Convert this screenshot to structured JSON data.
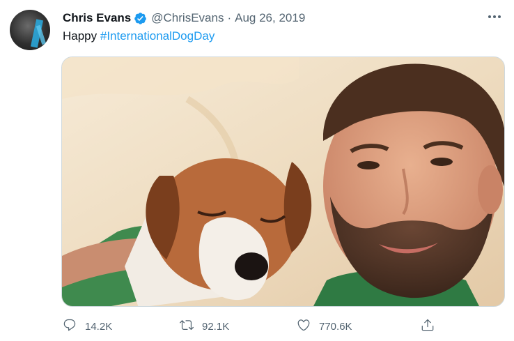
{
  "tweet": {
    "author_name": "Chris Evans",
    "handle": "@ChrisEvans",
    "separator": "·",
    "date": "Aug 26, 2019",
    "text_prefix": "Happy ",
    "hashtag": "#InternationalDogDay",
    "accent_color": "#1d9bf0"
  },
  "actions": {
    "replies": "14.2K",
    "retweets": "92.1K",
    "likes": "770.6K"
  },
  "icons": {
    "verified": "verified-badge-icon",
    "more": "more-options-icon",
    "reply": "reply-icon",
    "retweet": "retweet-icon",
    "like": "heart-icon",
    "share": "share-icon"
  }
}
